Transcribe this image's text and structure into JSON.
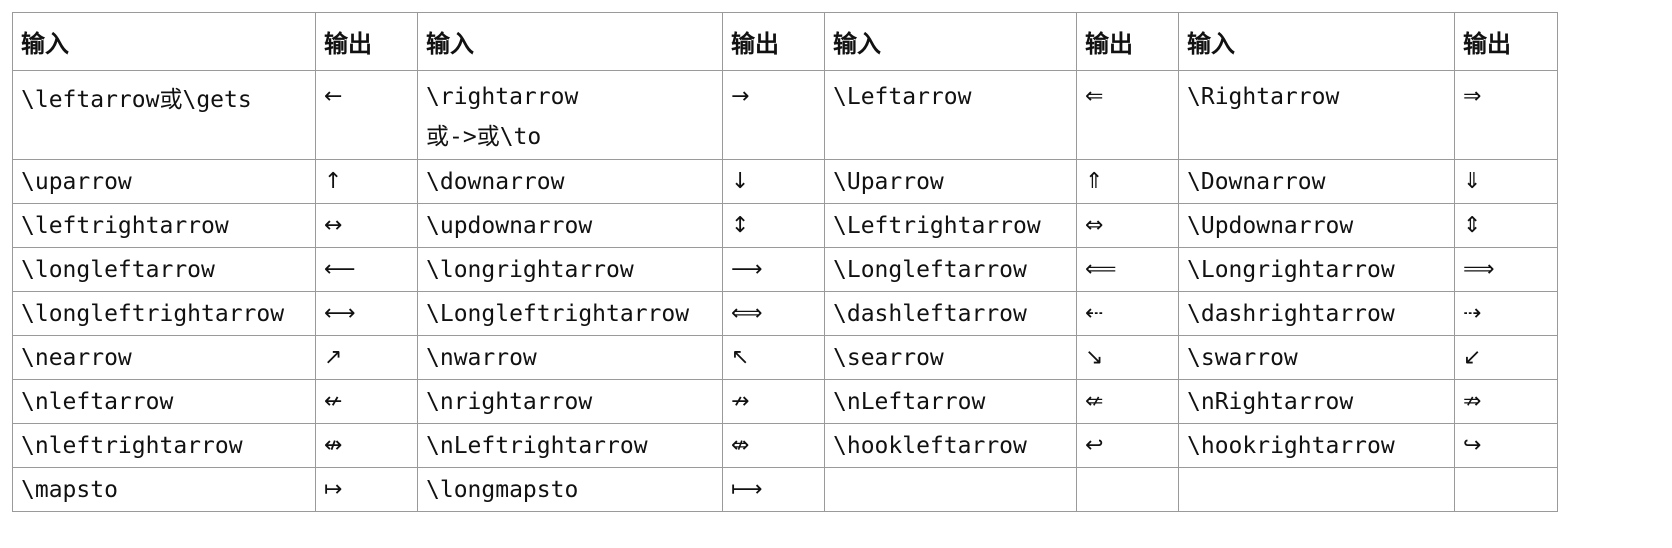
{
  "header": {
    "input": "输入",
    "output": "输出"
  },
  "row1": {
    "c1": "\\leftarrow或\\gets",
    "o1": "←",
    "c2_line1": "\\rightarrow",
    "c2_line2": "或->或\\to",
    "o2": "→",
    "c3": "\\Leftarrow",
    "o3": "⇐",
    "c4": "\\Rightarrow",
    "o4": "⇒"
  },
  "rows": [
    {
      "c1": "\\uparrow",
      "o1": "↑",
      "c2": "\\downarrow",
      "o2": "↓",
      "c3": "\\Uparrow",
      "o3": "⇑",
      "c4": "\\Downarrow",
      "o4": "⇓"
    },
    {
      "c1": "\\leftrightarrow",
      "o1": "↔",
      "c2": "\\updownarrow",
      "o2": "↕",
      "c3": "\\Leftrightarrow",
      "o3": "⇔",
      "c4": "\\Updownarrow",
      "o4": "⇕"
    },
    {
      "c1": "\\longleftarrow",
      "o1": "⟵",
      "c2": "\\longrightarrow",
      "o2": "⟶",
      "c3": "\\Longleftarrow",
      "o3": "⟸",
      "c4": "\\Longrightarrow",
      "o4": "⟹"
    },
    {
      "c1": "\\longleftrightarrow",
      "o1": "⟷",
      "c2": "\\Longleftrightarrow",
      "o2": "⟺",
      "c3": "\\dashleftarrow",
      "o3": "⇠",
      "c4": "\\dashrightarrow",
      "o4": "⇢"
    },
    {
      "c1": "\\nearrow",
      "o1": "↗",
      "c2": "\\nwarrow",
      "o2": "↖",
      "c3": "\\searrow",
      "o3": "↘",
      "c4": "\\swarrow",
      "o4": "↙"
    },
    {
      "c1": "\\nleftarrow",
      "o1": "↚",
      "c2": "\\nrightarrow",
      "o2": "↛",
      "c3": "\\nLeftarrow",
      "o3": "⇍",
      "c4": "\\nRightarrow",
      "o4": "⇏"
    },
    {
      "c1": "\\nleftrightarrow",
      "o1": "↮",
      "c2": "\\nLeftrightarrow",
      "o2": "⇎",
      "c3": "\\hookleftarrow",
      "o3": "↩",
      "c4": "\\hookrightarrow",
      "o4": "↪"
    },
    {
      "c1": "\\mapsto",
      "o1": "↦",
      "c2": "\\longmapsto",
      "o2": "⟼",
      "c3": "",
      "o3": "",
      "c4": "",
      "o4": ""
    }
  ]
}
